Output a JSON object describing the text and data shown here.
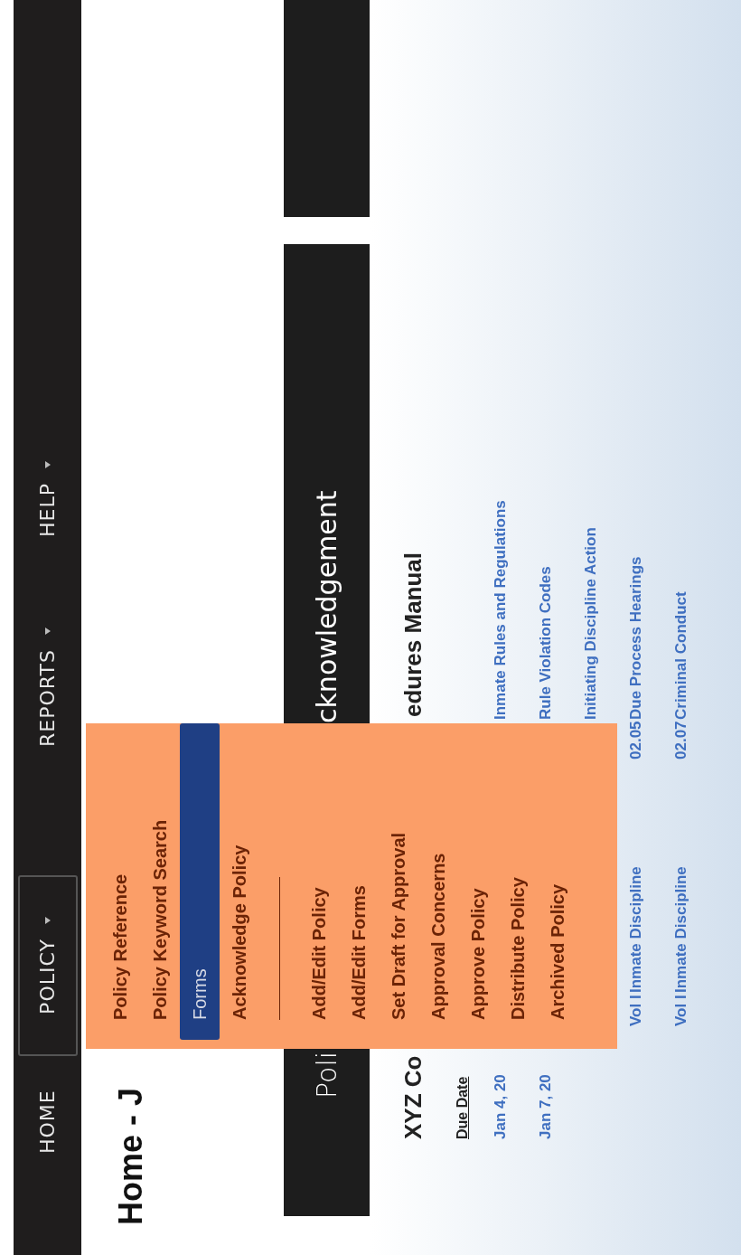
{
  "nav": [
    {
      "label": "HOME",
      "selected": false,
      "has_menu": false
    },
    {
      "label": "POLICY",
      "selected": true,
      "has_menu": true
    },
    {
      "label": "REPORTS",
      "selected": false,
      "has_menu": true
    },
    {
      "label": "HELP",
      "selected": false,
      "has_menu": true
    }
  ],
  "page_title": "Home - J",
  "banner": {
    "left_text": "Poli",
    "right_text": "cknowledgement"
  },
  "manual": {
    "left_text": "XYZ Co",
    "right_text": "edures Manual"
  },
  "table": {
    "header": "Due Date",
    "rows": [
      {
        "date": "Jan 4, 20",
        "title": "Inmate Rules and Regulations"
      },
      {
        "date": "Jan 7, 20",
        "title": "Rule Violation Codes"
      },
      {
        "title": "Initiating Discipline Action"
      },
      {
        "volume": "Vol I",
        "chapter": "Inmate Discipline",
        "section": "02.05",
        "title": "Due Process Hearings"
      },
      {
        "volume": "Vol I",
        "chapter": "Inmate Discipline",
        "section": "02.07",
        "title": "Criminal Conduct"
      }
    ]
  },
  "policy_menu": [
    {
      "kind": "item",
      "label": "Policy Reference",
      "selected": false
    },
    {
      "kind": "item",
      "label": "Policy Keyword Search",
      "selected": false
    },
    {
      "kind": "item",
      "label": "Forms",
      "selected": true
    },
    {
      "kind": "item",
      "label": "Acknowledge Policy",
      "selected": false
    },
    {
      "kind": "separator"
    },
    {
      "kind": "item",
      "label": "Add/Edit Policy",
      "selected": false
    },
    {
      "kind": "item",
      "label": "Add/Edit Forms",
      "selected": false
    },
    {
      "kind": "item",
      "label": "Set Draft for Approval",
      "selected": false
    },
    {
      "kind": "item",
      "label": "Approval Concerns",
      "selected": false
    },
    {
      "kind": "item",
      "label": "Approve Policy",
      "selected": false
    },
    {
      "kind": "item",
      "label": "Distribute Policy",
      "selected": false
    },
    {
      "kind": "item",
      "label": "Archived Policy",
      "selected": false
    }
  ]
}
